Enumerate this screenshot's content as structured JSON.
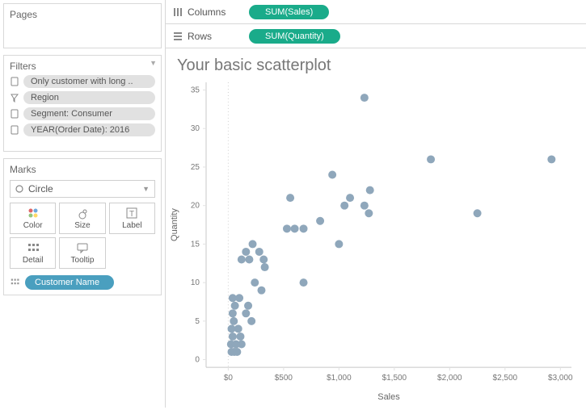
{
  "left": {
    "pages_title": "Pages",
    "filters_title": "Filters",
    "marks_title": "Marks",
    "mark_type": "Circle",
    "marks_buttons": {
      "color": "Color",
      "size": "Size",
      "label": "Label",
      "detail": "Detail",
      "tooltip": "Tooltip"
    },
    "filters": [
      "Only customer with long ..",
      "Region",
      "Segment: Consumer",
      "YEAR(Order Date): 2016"
    ],
    "detail_pill": "Customer Name"
  },
  "shelves": {
    "columns_label": "Columns",
    "columns_pill": "SUM(Sales)",
    "rows_label": "Rows",
    "rows_pill": "SUM(Quantity)"
  },
  "viz": {
    "title": "Your basic scatterplot",
    "xlabel": "Sales",
    "ylabel": "Quantity",
    "x_ticks": [
      0,
      500,
      1000,
      1500,
      2000,
      2500,
      3000
    ],
    "x_tick_labels": [
      "$0",
      "$500",
      "$1,000",
      "$1,500",
      "$2,000",
      "$2,500",
      "$3,000"
    ],
    "y_ticks": [
      0,
      5,
      10,
      15,
      20,
      25,
      30,
      35
    ]
  },
  "chart_data": {
    "type": "scatter",
    "title": "Your basic scatterplot",
    "xlabel": "Sales",
    "ylabel": "Quantity",
    "xlim": [
      -200,
      3100
    ],
    "ylim": [
      -1,
      36
    ],
    "points": [
      {
        "x": 30,
        "y": 1
      },
      {
        "x": 55,
        "y": 1
      },
      {
        "x": 80,
        "y": 1
      },
      {
        "x": 25,
        "y": 2
      },
      {
        "x": 70,
        "y": 2
      },
      {
        "x": 120,
        "y": 2
      },
      {
        "x": 40,
        "y": 3
      },
      {
        "x": 110,
        "y": 3
      },
      {
        "x": 30,
        "y": 4
      },
      {
        "x": 90,
        "y": 4
      },
      {
        "x": 50,
        "y": 5
      },
      {
        "x": 210,
        "y": 5
      },
      {
        "x": 160,
        "y": 6
      },
      {
        "x": 40,
        "y": 6
      },
      {
        "x": 60,
        "y": 7
      },
      {
        "x": 180,
        "y": 7
      },
      {
        "x": 40,
        "y": 8
      },
      {
        "x": 100,
        "y": 8
      },
      {
        "x": 300,
        "y": 9
      },
      {
        "x": 240,
        "y": 10
      },
      {
        "x": 680,
        "y": 10
      },
      {
        "x": 330,
        "y": 12
      },
      {
        "x": 120,
        "y": 13
      },
      {
        "x": 190,
        "y": 13
      },
      {
        "x": 320,
        "y": 13
      },
      {
        "x": 160,
        "y": 14
      },
      {
        "x": 280,
        "y": 14
      },
      {
        "x": 220,
        "y": 15
      },
      {
        "x": 1000,
        "y": 15
      },
      {
        "x": 600,
        "y": 17
      },
      {
        "x": 680,
        "y": 17
      },
      {
        "x": 530,
        "y": 17
      },
      {
        "x": 830,
        "y": 18
      },
      {
        "x": 1270,
        "y": 19
      },
      {
        "x": 2250,
        "y": 19
      },
      {
        "x": 1050,
        "y": 20
      },
      {
        "x": 1230,
        "y": 20
      },
      {
        "x": 560,
        "y": 21
      },
      {
        "x": 1100,
        "y": 21
      },
      {
        "x": 1280,
        "y": 22
      },
      {
        "x": 940,
        "y": 24
      },
      {
        "x": 1830,
        "y": 26
      },
      {
        "x": 2920,
        "y": 26
      },
      {
        "x": 1230,
        "y": 34
      }
    ]
  }
}
